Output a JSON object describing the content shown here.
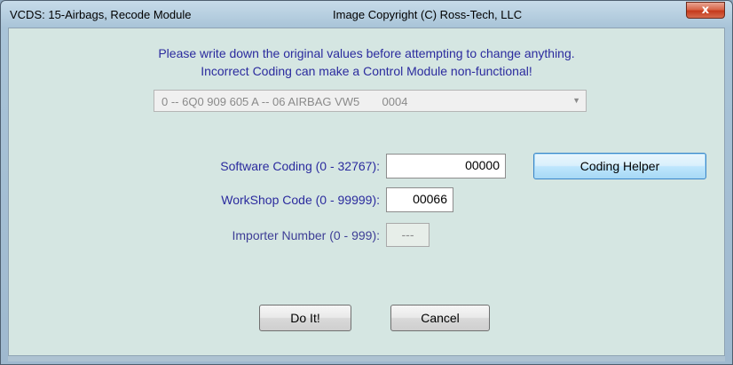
{
  "window": {
    "title": "VCDS: 15-Airbags,  Recode Module",
    "copyright": "Image Copyright (C) Ross-Tech, LLC",
    "close_glyph": "x"
  },
  "warning": {
    "line1": "Please write down the original values before attempting to change anything.",
    "line2": "Incorrect Coding can make a Control Module non-functional!"
  },
  "module_select": {
    "value": "0 -- 6Q0 909 605 A -- 06 AIRBAG VW5       0004"
  },
  "fields": {
    "software_coding": {
      "label": "Software Coding (0 - 32767):",
      "value": "00000"
    },
    "workshop_code": {
      "label": "WorkShop Code (0 - 99999):",
      "value": "00066"
    },
    "importer_number": {
      "label": "Importer Number (0 - 999):",
      "value": "---"
    }
  },
  "buttons": {
    "coding_helper": "Coding Helper",
    "do_it": "Do It!",
    "cancel": "Cancel"
  },
  "colors": {
    "label_text": "#2b2b9e",
    "client_background": "#d5e6e2",
    "close_button": "#c53a1c"
  }
}
